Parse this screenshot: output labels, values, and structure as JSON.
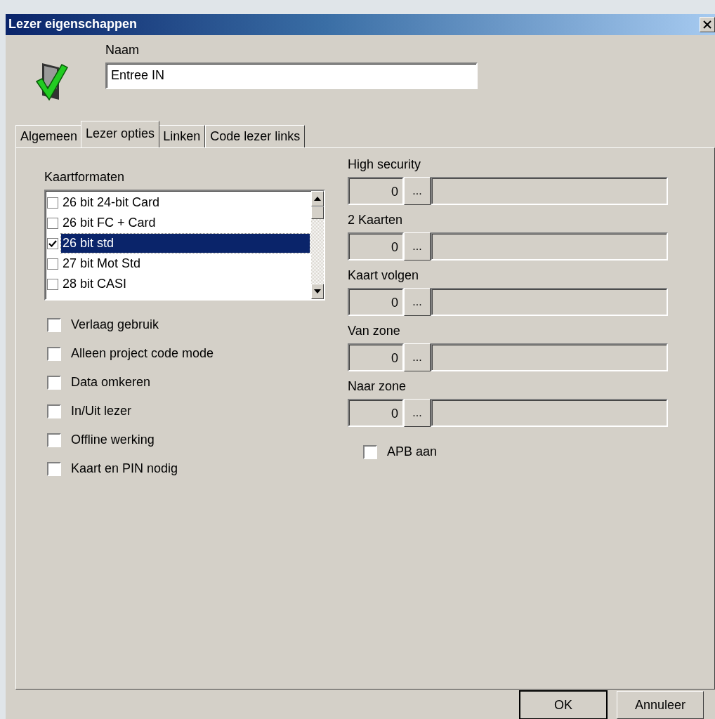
{
  "window": {
    "title": "Lezer eigenschappen"
  },
  "name_field": {
    "label": "Naam",
    "value": "Entree IN"
  },
  "tabs": [
    {
      "label": "Algemeen",
      "selected": false
    },
    {
      "label": "Lezer opties",
      "selected": true
    },
    {
      "label": "Linken",
      "selected": false
    },
    {
      "label": "Code lezer links",
      "selected": false
    }
  ],
  "card_formats": {
    "label": "Kaartformaten",
    "items": [
      {
        "label": "26 bit 24-bit Card",
        "checked": false,
        "selected": false
      },
      {
        "label": "26 bit FC + Card",
        "checked": false,
        "selected": false
      },
      {
        "label": "26 bit std",
        "checked": true,
        "selected": true
      },
      {
        "label": "27 bit Mot Std",
        "checked": false,
        "selected": false
      },
      {
        "label": "28 bit CASI",
        "checked": false,
        "selected": false
      }
    ]
  },
  "options": [
    {
      "label": "Verlaag gebruik",
      "checked": false
    },
    {
      "label": "Alleen project code mode",
      "checked": false
    },
    {
      "label": "Data omkeren",
      "checked": false
    },
    {
      "label": "In/Uit lezer",
      "checked": false
    },
    {
      "label": "Offline werking",
      "checked": false
    },
    {
      "label": "Kaart en PIN nodig",
      "checked": false
    }
  ],
  "lookups": [
    {
      "label": "High security",
      "value": "0",
      "button": "...",
      "disabled": true
    },
    {
      "label": "2 Kaarten",
      "value": "0",
      "button": "...",
      "disabled": true
    },
    {
      "label": "Kaart volgen",
      "value": "0",
      "button": "...",
      "disabled": true
    },
    {
      "label": "Van zone",
      "value": "0",
      "button": "...",
      "disabled": true
    },
    {
      "label": "Naar zone",
      "value": "0",
      "button": "...",
      "disabled": true
    }
  ],
  "apb": {
    "label": "APB aan",
    "checked": false
  },
  "buttons": [
    {
      "label": "OK",
      "default": true
    },
    {
      "label": "Annuleer",
      "default": false
    }
  ]
}
